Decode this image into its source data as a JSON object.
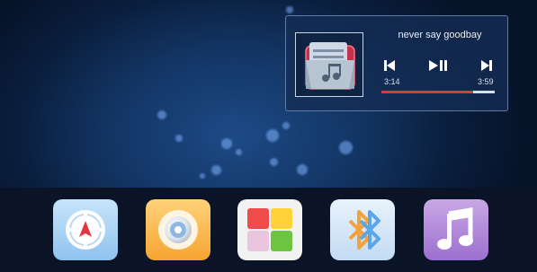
{
  "player": {
    "song_title": "never say goodbay",
    "elapsed": "3:14",
    "duration": "3:59",
    "progress": 0.81,
    "controls": [
      "previous-icon",
      "play-pause-icon",
      "next-icon"
    ]
  },
  "dock": {
    "apps": [
      "navigation-icon",
      "disc-player-icon",
      "gallery-icon",
      "bluetooth-icon",
      "music-icon"
    ]
  },
  "colors": {
    "accent": "#e0373f",
    "dock_bg": "#0a1426"
  }
}
